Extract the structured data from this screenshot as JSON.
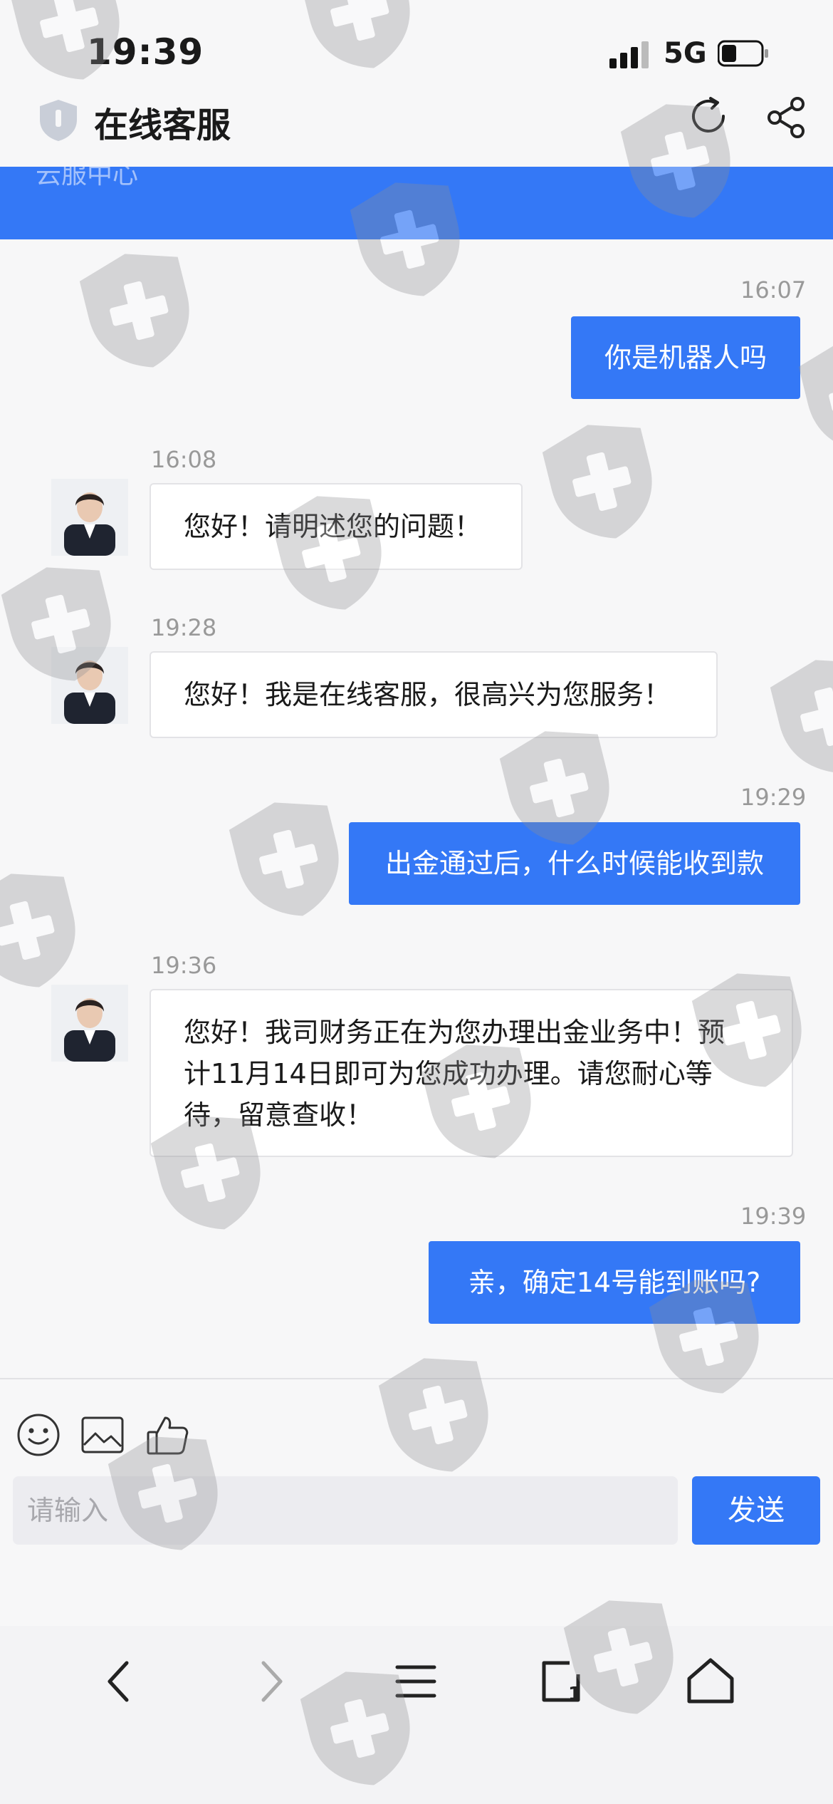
{
  "status_bar": {
    "time": "19:39",
    "network": "5G"
  },
  "header": {
    "title": "在线客服"
  },
  "banner": {
    "text": "云服中心"
  },
  "messages": [
    {
      "time": "16:07",
      "from": "user",
      "text": "你是机器人吗"
    },
    {
      "time": "16:08",
      "from": "agent",
      "text": "您好！请明述您的问题！"
    },
    {
      "time": "19:28",
      "from": "agent",
      "text": "您好！我是在线客服，很高兴为您服务！"
    },
    {
      "time": "19:29",
      "from": "user",
      "text": "出金通过后，什么时候能收到款"
    },
    {
      "time": "19:36",
      "from": "agent",
      "lines": [
        "您好！我司财务正在为您办理出金业务中！预",
        "计11月14日即可为您成功办理。请您耐心等",
        "待，留意查收！"
      ]
    },
    {
      "time": "19:39",
      "from": "user",
      "text": "亲，确定14号能到账吗?"
    }
  ],
  "composer": {
    "placeholder": "请输入",
    "send_label": "发送"
  },
  "tools": [
    "emoji-icon",
    "image-icon",
    "thumbs-up-icon"
  ],
  "bottom_nav": [
    "back-icon",
    "forward-icon",
    "menu-icon",
    "tabs-icon",
    "home-icon"
  ],
  "colors": {
    "accent": "#3478f6",
    "background": "#f7f7f8",
    "bubble_in": "#ffffff"
  }
}
